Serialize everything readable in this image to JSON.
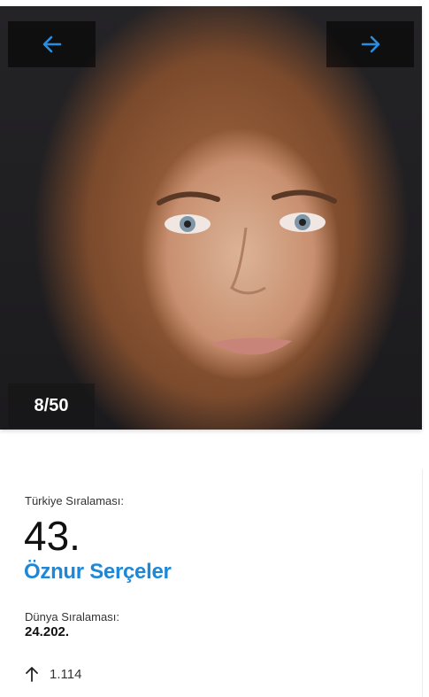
{
  "gallery": {
    "counter": "8/50",
    "prev_icon": "arrow-left-icon",
    "next_icon": "arrow-right-icon",
    "accent_color": "#1e88d8"
  },
  "profile": {
    "turkey_rank_label": "Türkiye Sıralaması:",
    "turkey_rank_value": "43.",
    "name": "Öznur Serçeler",
    "world_rank_label": "Dünya Sıralaması:",
    "world_rank_value": "24.202.",
    "trend_icon": "arrow-up-icon",
    "trend_value": "1.114"
  }
}
